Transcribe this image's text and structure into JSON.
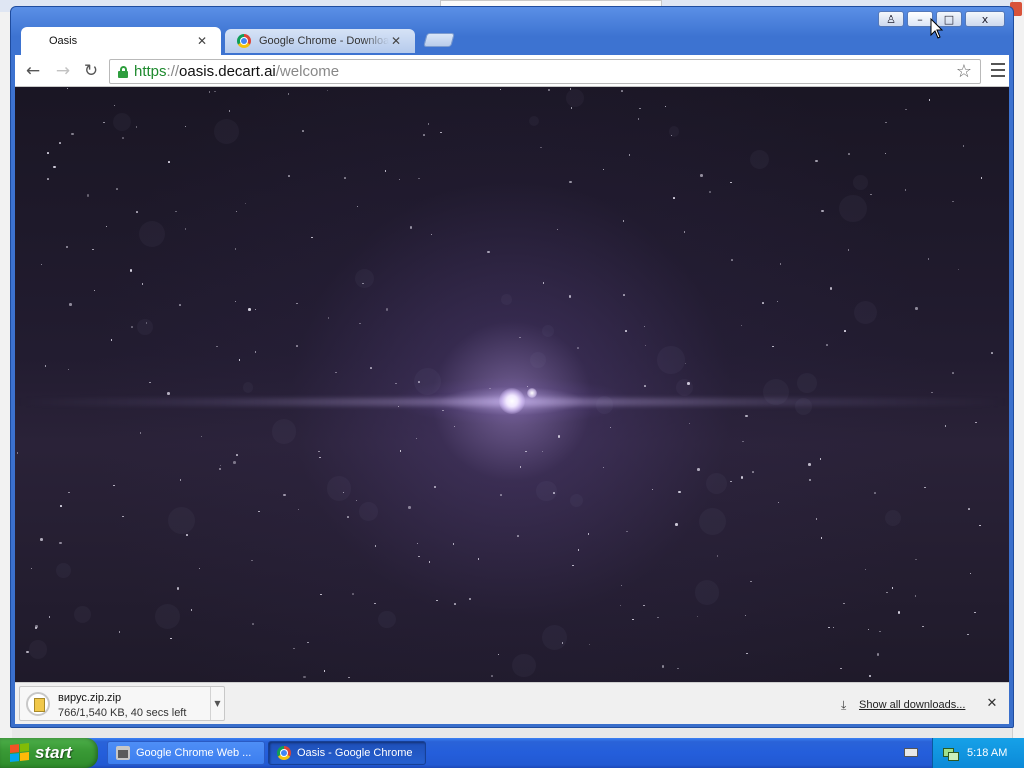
{
  "window": {
    "caption_buttons": {
      "user": "♙",
      "minimize": "–",
      "maximize": "□",
      "close": "x"
    }
  },
  "tabs": [
    {
      "title": "Oasis",
      "active": true,
      "icon": "none"
    },
    {
      "title": "Google Chrome - Download Google Chrome",
      "active": false,
      "icon": "chrome-icon"
    }
  ],
  "tab_close_glyph": "✕",
  "toolbar": {
    "back_glyph": "←",
    "forward_glyph": "→",
    "reload_glyph": "↻",
    "url": {
      "scheme": "https",
      "separator": "://",
      "host": "oasis.decart.ai",
      "path": "/welcome"
    },
    "star_glyph": "☆"
  },
  "content": {
    "description_color": "#211b2d"
  },
  "downloads": {
    "items": [
      {
        "name": "вирус.zip.zip",
        "status": "766/1,540 KB, 40 secs left",
        "dropdown_glyph": "▼"
      }
    ],
    "show_all_label": "Show all downloads...",
    "show_all_glyph": "⤓",
    "close_glyph": "✕"
  },
  "taskbar": {
    "start_label": "start",
    "buttons": [
      {
        "label": "Google Chrome Web ...",
        "icon": "store-icon",
        "active": false
      },
      {
        "label": "Oasis - Google Chrome",
        "icon": "chrome-icon",
        "active": true
      }
    ],
    "clock": "5:18 AM"
  },
  "colors": {
    "title_bar": "#3d73d1",
    "taskbar": "#245edb",
    "start_button": "#3a9a36",
    "url_scheme": "#1e8a2e",
    "lock": "#2e9e3e",
    "space_bg": "#211b2d"
  }
}
